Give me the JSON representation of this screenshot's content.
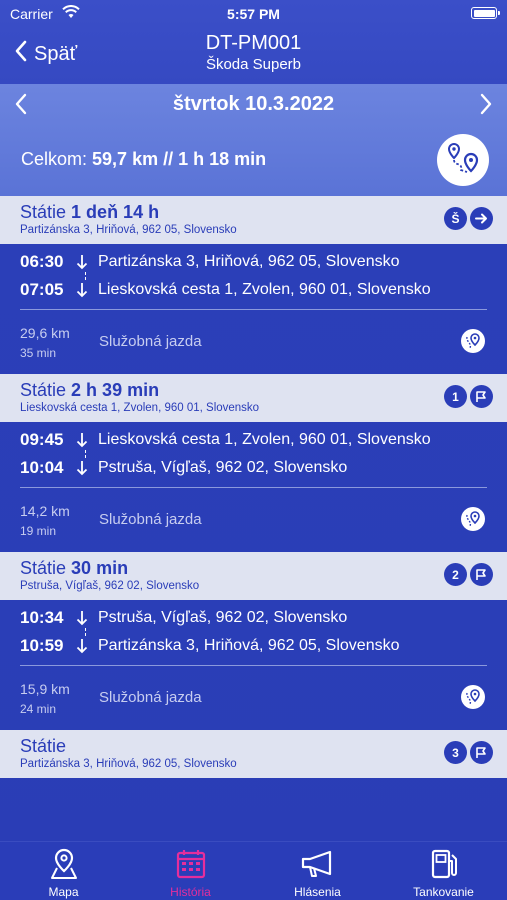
{
  "status_bar": {
    "carrier": "Carrier",
    "time": "5:57 PM"
  },
  "nav": {
    "back_label": "Späť",
    "title": "DT-PM001",
    "subtitle": "Škoda Superb"
  },
  "date_header": {
    "date": "štvrtok 10.3.2022",
    "total_prefix": "Celkom:",
    "total_value": "59,7 km // 1 h 18 min"
  },
  "stops": [
    {
      "label": "Státie",
      "duration": "1 deň 14 h",
      "address": "Partizánska 3, Hriňová, 962 05, Slovensko",
      "badge": "Š",
      "badge_icon": "arrow-right-icon"
    },
    {
      "label": "Státie",
      "duration": "2 h 39 min",
      "address": "Lieskovská cesta 1, Zvolen, 960 01, Slovensko",
      "badge": "1",
      "badge_icon": "flag-icon"
    },
    {
      "label": "Státie",
      "duration": "30 min",
      "address": "Pstruša, Vígľaš, 962 02, Slovensko",
      "badge": "2",
      "badge_icon": "flag-icon"
    },
    {
      "label": "Státie",
      "duration": "",
      "address": "Partizánska 3, Hriňová, 962 05, Slovensko",
      "badge": "3",
      "badge_icon": "flag-icon"
    }
  ],
  "trips": [
    {
      "start_time": "06:30",
      "start_place": "Partizánska 3, Hriňová, 962 05, Slovensko",
      "end_time": "07:05",
      "end_place": "Lieskovská cesta 1, Zvolen, 960 01, Slovensko",
      "distance": "29,6 km",
      "duration": "35 min",
      "type": "Služobná jazda"
    },
    {
      "start_time": "09:45",
      "start_place": "Lieskovská cesta 1, Zvolen, 960 01, Slovensko",
      "end_time": "10:04",
      "end_place": "Pstruša, Vígľaš, 962 02, Slovensko",
      "distance": "14,2 km",
      "duration": "19 min",
      "type": "Služobná jazda"
    },
    {
      "start_time": "10:34",
      "start_place": "Pstruša, Vígľaš, 962 02, Slovensko",
      "end_time": "10:59",
      "end_place": "Partizánska 3, Hriňová, 962 05, Slovensko",
      "distance": "15,9 km",
      "duration": "24 min",
      "type": "Služobná jazda"
    }
  ],
  "tabs": [
    {
      "label": "Mapa",
      "icon": "map-pin-icon"
    },
    {
      "label": "História",
      "icon": "calendar-icon",
      "active": true
    },
    {
      "label": "Hlásenia",
      "icon": "megaphone-icon"
    },
    {
      "label": "Tankovanie",
      "icon": "fuel-icon"
    }
  ],
  "colors": {
    "background": "#2a3db8",
    "stop_row": "#dfe3f1",
    "active_tab": "#e52e9c",
    "header_panel": "#6c84df"
  }
}
